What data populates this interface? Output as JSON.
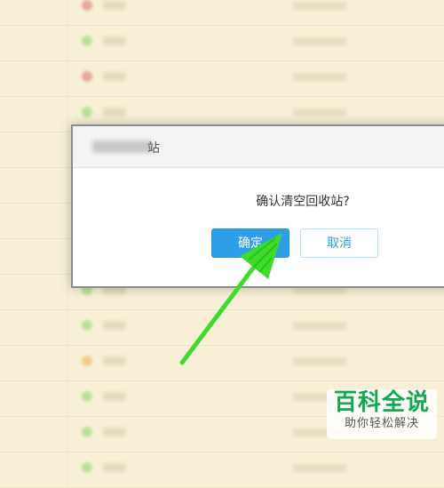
{
  "dialog": {
    "title_tail": "站",
    "message": "确认清空回收站?",
    "confirm_label": "确定",
    "cancel_label": "取消"
  },
  "watermark": {
    "title": "百科全说",
    "subtitle": "助你轻松解决"
  },
  "colors": {
    "page_background": "#f7f0d7",
    "primary_button": "#2f9ee8",
    "arrow": "#3ddc2a",
    "watermark_green": "#13a94f"
  },
  "background_list": {
    "status_dot_colors": [
      "#e06a6a",
      "#8bd46c",
      "#e06a6a",
      "#8bd46c",
      "#e06a6a",
      "#e06a6a",
      "#8bd46c",
      "#8bd46c",
      "#8bd46c",
      "#8bd46c",
      "#f0b050",
      "#8bd46c",
      "#8bd46c",
      "#8bd46c"
    ]
  }
}
